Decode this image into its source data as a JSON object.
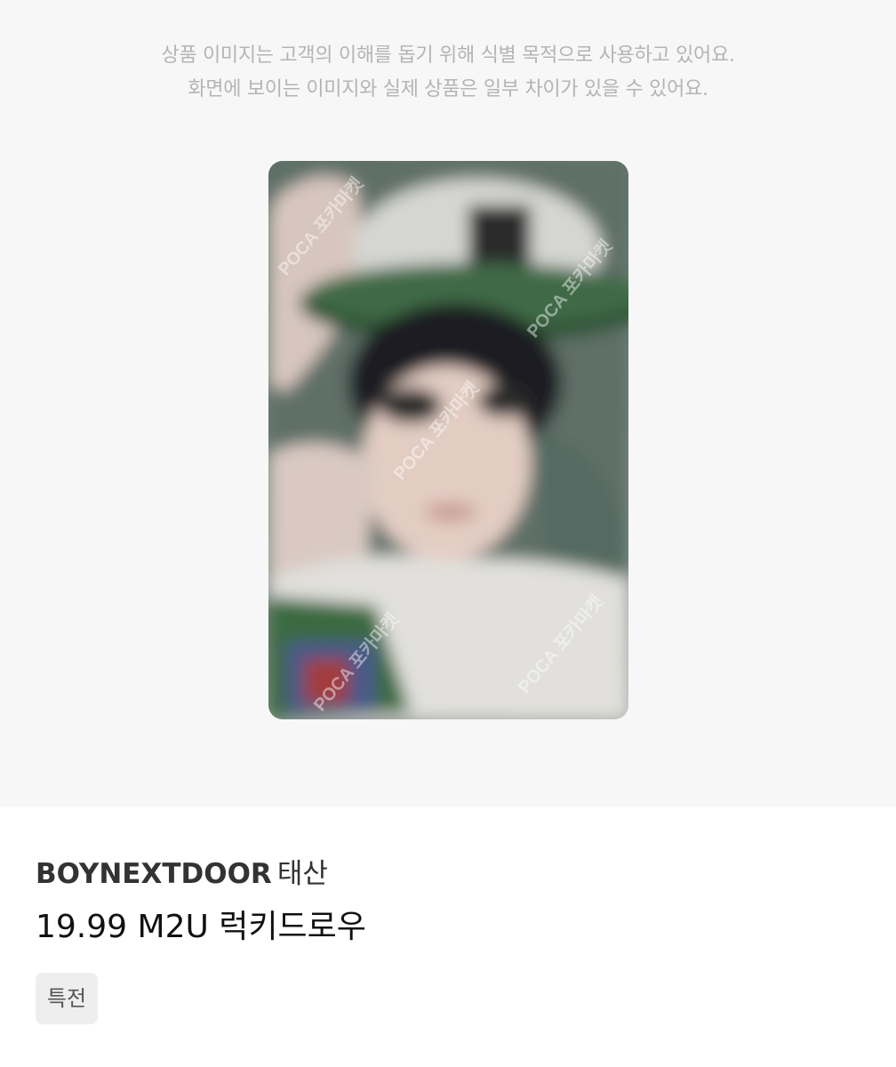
{
  "disclaimer": {
    "line1": "상품 이미지는 고객의 이해를 돕기 위해 식별 목적으로 사용하고 있어요.",
    "line2": "화면에 보이는 이미지와 실제 상품은 일부 차이가 있을 수 있어요."
  },
  "photocard": {
    "watermark": "POCA 포카마켓"
  },
  "product": {
    "artist": "BOYNEXTDOOR",
    "member": "태산",
    "name": "19.99 M2U 럭키드로우",
    "tag": "특전"
  }
}
